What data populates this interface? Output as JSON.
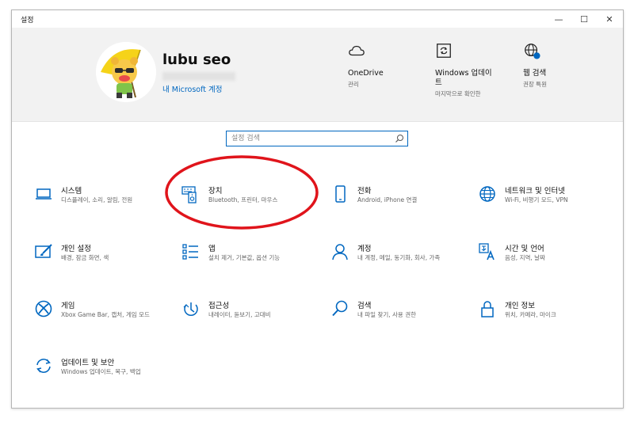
{
  "window": {
    "title": "설정",
    "minimize": "—",
    "maximize": "☐",
    "close": "✕"
  },
  "user": {
    "name": "lubu seo",
    "account_link": "내 Microsoft 계정"
  },
  "quick": [
    {
      "title": "OneDrive",
      "subtitle": "관리"
    },
    {
      "title": "Windows 업데이트",
      "subtitle": "마지막으로 확인한"
    },
    {
      "title": "웹 검색",
      "subtitle": "권장 특원"
    }
  ],
  "search": {
    "placeholder": "설정 검색"
  },
  "categories": [
    {
      "title": "시스템",
      "subtitle": "디스플레이, 소리, 알림, 전원"
    },
    {
      "title": "장치",
      "subtitle": "Bluetooth, 프린터, 마우스"
    },
    {
      "title": "전화",
      "subtitle": "Android, iPhone 연결"
    },
    {
      "title": "네트워크 및 인터넷",
      "subtitle": "Wi-Fi, 비행기 모드, VPN"
    },
    {
      "title": "개인 설정",
      "subtitle": "배경, 잠금 화면, 색"
    },
    {
      "title": "앱",
      "subtitle": "설치 제거, 기본값, 옵션 기능"
    },
    {
      "title": "계정",
      "subtitle": "내 계정, 메일, 동기화, 회사, 가족"
    },
    {
      "title": "시간 및 언어",
      "subtitle": "음성, 지역, 날짜"
    },
    {
      "title": "게임",
      "subtitle": "Xbox Game Bar, 캡처, 게임 모드"
    },
    {
      "title": "접근성",
      "subtitle": "내레이터, 돋보기, 고대비"
    },
    {
      "title": "검색",
      "subtitle": "내 파일 찾기, 사용 권한"
    },
    {
      "title": "개인 정보",
      "subtitle": "위치, 카메라, 마이크"
    },
    {
      "title": "업데이트 및 보안",
      "subtitle": "Windows 업데이트, 복구, 백업"
    }
  ],
  "colors": {
    "accent": "#0067c0",
    "annotation": "#e0141b",
    "header_bg": "#f2f2f2"
  }
}
